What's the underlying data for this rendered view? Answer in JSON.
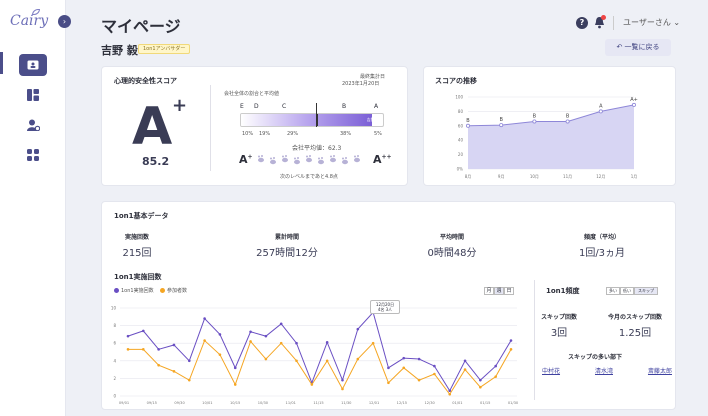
{
  "app": {
    "logo": "Cairy"
  },
  "header": {
    "title": "マイページ",
    "user": "ユーザーさん ⌄",
    "help": "?"
  },
  "profile": {
    "name": "吉野 毅",
    "badge": "1on1アンバサダー",
    "back_label": "一覧に戻る"
  },
  "psych": {
    "title": "心理的安全性スコア",
    "grade": "A",
    "grade_plus": "+",
    "score": "85.2",
    "updated_label": "最終集計日",
    "updated_date": "2023年1月20日",
    "scale_caption": "会社全体の割合と平均値",
    "letters": [
      "E",
      "D",
      "C",
      "B",
      "A"
    ],
    "percents": [
      "10%",
      "19%",
      "29%",
      "38%",
      "5%"
    ],
    "you_label": "吉野 毅",
    "company_avg": "会社平均値：62.3",
    "next_level": "次のレベルまであと4.8点",
    "from_grade": "A",
    "from_plus": "+",
    "to_grade": "A",
    "to_plus": "++",
    "fill_fraction": 0.91
  },
  "trend": {
    "title": "スコアの推移",
    "chart_data": {
      "type": "area",
      "categories": [
        "8月",
        "9月",
        "10月",
        "11月",
        "12月",
        "1月"
      ],
      "values": [
        60,
        61,
        66,
        66,
        80,
        89
      ],
      "point_labels": [
        "B",
        "B",
        "B",
        "B",
        "A",
        "A+"
      ],
      "ylim": [
        0,
        100
      ],
      "yticks": [
        "100",
        "80",
        "60",
        "40",
        "20",
        "0%"
      ]
    }
  },
  "basic": {
    "title": "1on1基本データ",
    "stats": [
      {
        "label": "実施回数",
        "value": "215回"
      },
      {
        "label": "累計時間",
        "value": "257時間12分"
      },
      {
        "label": "平均時間",
        "value": "0時間48分"
      },
      {
        "label": "頻度（平均）",
        "value": "1回/3ヵ月"
      }
    ]
  },
  "count_chart": {
    "title": "1on1実施回数",
    "toggle": [
      "月",
      "週",
      "日"
    ],
    "tooltip_date": "12月20日",
    "tooltip_a": "4名",
    "tooltip_b": "3人",
    "chart_data": {
      "type": "line",
      "x": [
        "09/01",
        "09/15",
        "09/30",
        "10/01",
        "10/15",
        "10/30",
        "11/01",
        "11/15",
        "11/30",
        "12/01",
        "12/15",
        "12/30",
        "01/01",
        "01/15",
        "01/30"
      ],
      "series": [
        {
          "name": "1on1実施回数",
          "color": "#6a4fc3",
          "values": [
            6.8,
            7.4,
            5.3,
            5.8,
            4.0,
            8.8,
            7.0,
            3.2,
            7.3,
            6.8,
            8.2,
            6.0,
            1.5,
            6.1,
            1.8,
            7.6,
            9.5,
            3.2,
            4.3,
            4.2,
            3.4,
            0.6,
            4.0,
            1.8,
            3.4,
            6.3
          ]
        },
        {
          "name": "参加者数",
          "color": "#f5a623",
          "values": [
            5.3,
            5.3,
            3.5,
            2.8,
            1.8,
            6.3,
            4.7,
            1.3,
            6.2,
            4.2,
            6.0,
            4.0,
            1.3,
            4.0,
            0.8,
            4.2,
            6.0,
            1.5,
            3.2,
            1.8,
            2.5,
            0.2,
            3.0,
            1.0,
            2.2,
            5.3
          ]
        }
      ],
      "ylim": [
        0,
        10
      ],
      "yticks": [
        "10",
        "8",
        "6",
        "4",
        "2",
        "0"
      ]
    }
  },
  "freq": {
    "title": "1on1頻度",
    "toggle": [
      "多い",
      "低い",
      "スキップ"
    ],
    "skip_label": "スキップ回数",
    "skip_value": "3回",
    "month_label": "今月のスキップ回数",
    "month_value": "1.25回",
    "members_label": "スキップの多い部下",
    "members": [
      "中村花",
      "清水湾",
      "斎藤太郎"
    ]
  }
}
